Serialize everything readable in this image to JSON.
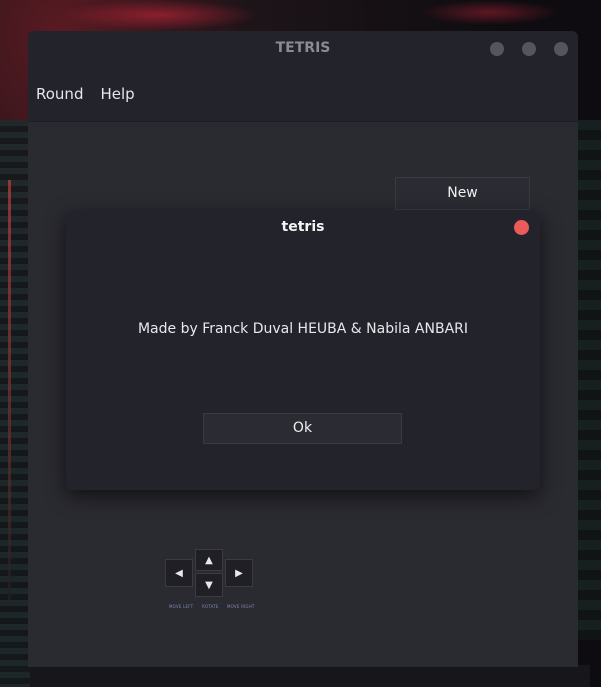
{
  "window": {
    "title": "TETRIS"
  },
  "menu": {
    "round": "Round",
    "help": "Help"
  },
  "game": {
    "new_label": "New",
    "controls": {
      "up_icon": "▲",
      "down_icon": "▼",
      "left_icon": "◀",
      "right_icon": "▶",
      "move_left_label": "MOVE LEFT",
      "rotate_label": "ROTATE",
      "move_right_label": "MOVE RIGHT"
    }
  },
  "dialog": {
    "title": "tetris",
    "message": "Made by Franck Duval HEUBA & Nabila ANBARI",
    "ok_label": "Ok"
  }
}
